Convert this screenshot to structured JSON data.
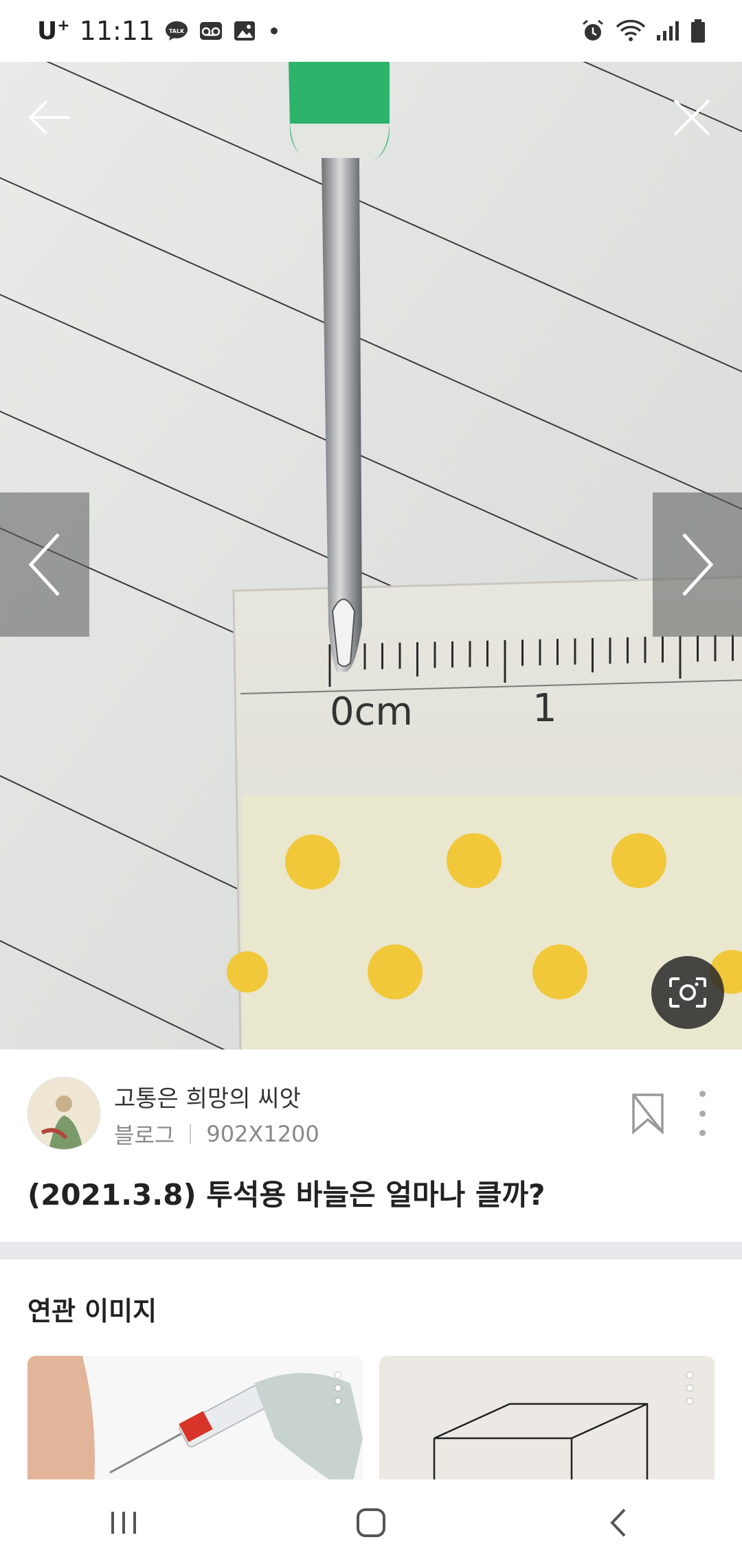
{
  "status_bar": {
    "carrier": "U",
    "carrier_sup": "+",
    "time": "11:11",
    "notification_icons": [
      "talk-icon",
      "voicemail-icon",
      "gallery-icon",
      "dot-icon"
    ],
    "system_icons": [
      "alarm-icon",
      "wifi-icon",
      "signal-icon",
      "battery-icon"
    ],
    "talk_badge": "TALK"
  },
  "viewer": {
    "ruler_label_zero": "0cm",
    "ruler_label_one": "1"
  },
  "post": {
    "author": "고통은 희망의 씨앗",
    "source": "블로그",
    "dimensions": "902X1200",
    "title": "(2021.3.8) 투석용 바늘은 얼마나 클까?"
  },
  "related": {
    "title": "연관 이미지"
  },
  "colors": {
    "needle_cap": "#2db36a",
    "dots": "#f0c83a",
    "divider": "#e6e8ec"
  }
}
